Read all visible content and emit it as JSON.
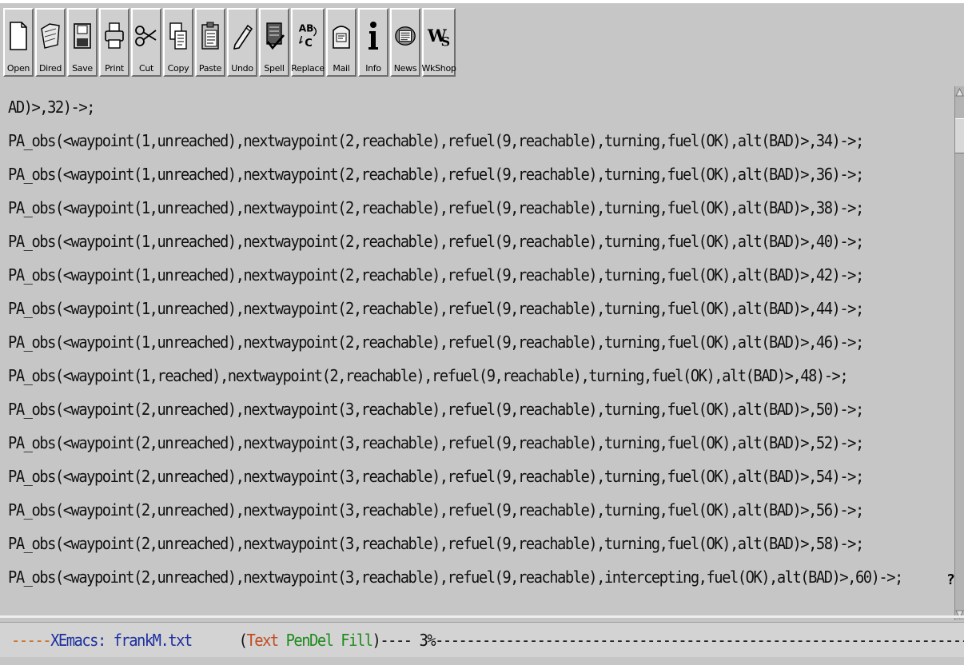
{
  "toolbar": {
    "buttons": [
      {
        "label": "Open",
        "icon": "document-icon"
      },
      {
        "label": "Dired",
        "icon": "folder-icon"
      },
      {
        "label": "Save",
        "icon": "floppy-disk-icon"
      },
      {
        "label": "Print",
        "icon": "printer-icon"
      },
      {
        "label": "Cut",
        "icon": "scissors-icon"
      },
      {
        "label": "Copy",
        "icon": "copy-pages-icon"
      },
      {
        "label": "Paste",
        "icon": "clipboard-icon"
      },
      {
        "label": "Undo",
        "icon": "pencil-eraser-icon"
      },
      {
        "label": "Spell",
        "icon": "spellcheck-book-icon"
      },
      {
        "label": "Replace",
        "icon": "replace-abc-icon"
      },
      {
        "label": "Mail",
        "icon": "mailbox-icon"
      },
      {
        "label": "Info",
        "icon": "info-icon"
      },
      {
        "label": "News",
        "icon": "newspaper-icon"
      },
      {
        "label": "WkShop",
        "icon": "workshop-ws-icon"
      }
    ]
  },
  "editor": {
    "lines": [
      "AD)>,32)->;",
      "PA_obs(<waypoint(1,unreached),nextwaypoint(2,reachable),refuel(9,reachable),turning,fuel(OK),alt(BAD)>,34)->;",
      "PA_obs(<waypoint(1,unreached),nextwaypoint(2,reachable),refuel(9,reachable),turning,fuel(OK),alt(BAD)>,36)->;",
      "PA_obs(<waypoint(1,unreached),nextwaypoint(2,reachable),refuel(9,reachable),turning,fuel(OK),alt(BAD)>,38)->;",
      "PA_obs(<waypoint(1,unreached),nextwaypoint(2,reachable),refuel(9,reachable),turning,fuel(OK),alt(BAD)>,40)->;",
      "PA_obs(<waypoint(1,unreached),nextwaypoint(2,reachable),refuel(9,reachable),turning,fuel(OK),alt(BAD)>,42)->;",
      "PA_obs(<waypoint(1,unreached),nextwaypoint(2,reachable),refuel(9,reachable),turning,fuel(OK),alt(BAD)>,44)->;",
      "PA_obs(<waypoint(1,unreached),nextwaypoint(2,reachable),refuel(9,reachable),turning,fuel(OK),alt(BAD)>,46)->;",
      "PA_obs(<waypoint(1,reached),nextwaypoint(2,reachable),refuel(9,reachable),turning,fuel(OK),alt(BAD)>,48)->;",
      "PA_obs(<waypoint(2,unreached),nextwaypoint(3,reachable),refuel(9,reachable),turning,fuel(OK),alt(BAD)>,50)->;",
      "PA_obs(<waypoint(2,unreached),nextwaypoint(3,reachable),refuel(9,reachable),turning,fuel(OK),alt(BAD)>,52)->;",
      "PA_obs(<waypoint(2,unreached),nextwaypoint(3,reachable),refuel(9,reachable),turning,fuel(OK),alt(BAD)>,54)->;",
      "PA_obs(<waypoint(2,unreached),nextwaypoint(3,reachable),refuel(9,reachable),turning,fuel(OK),alt(BAD)>,56)->;",
      "PA_obs(<waypoint(2,unreached),nextwaypoint(3,reachable),refuel(9,reachable),turning,fuel(OK),alt(BAD)>,58)->;",
      "PA_obs(<waypoint(2,unreached),nextwaypoint(3,reachable),refuel(9,reachable),intercepting,fuel(OK),alt(BAD)>,60)->;"
    ],
    "wrap_indicator": "?"
  },
  "modeline": {
    "leading_dashes": "-----",
    "buffer": "XEmacs: frankM.txt",
    "gap": "      ",
    "open_paren": "(",
    "mode_text": "Text",
    "mode_pendel": "PenDel",
    "mode_fill": "Fill",
    "close_and_pos": ")---- 3%----------------------------------------------------------------------"
  },
  "colors": {
    "background": "#c6c6c6",
    "modeline_buffer": "#1c2fa0",
    "modeline_text_mode": "#c24a1e",
    "modeline_minor_modes": "#1e8a1e",
    "modeline_dashes": "#c86a1e"
  }
}
